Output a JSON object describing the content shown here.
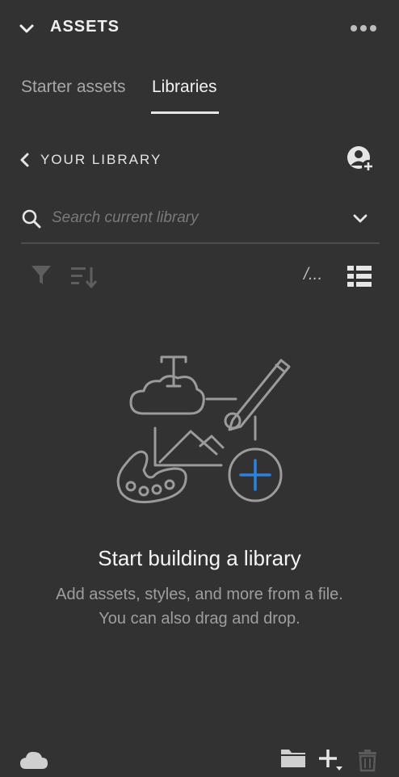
{
  "panel": {
    "title": "ASSETS"
  },
  "tabs": [
    {
      "label": "Starter assets",
      "active": false
    },
    {
      "label": "Libraries",
      "active": true
    }
  ],
  "library": {
    "back_label": "YOUR LIBRARY"
  },
  "search": {
    "placeholder": "Search current library",
    "value": ""
  },
  "toolbar": {
    "view_truncated_label": "/..."
  },
  "empty_state": {
    "title": "Start building a library",
    "description_line1": "Add assets, styles, and more from a file.",
    "description_line2": "You can also drag and drop."
  },
  "icons": {
    "header": [
      "chevron-down-icon",
      "more-options-icon"
    ],
    "library": [
      "chevron-left-icon",
      "add-user-icon"
    ],
    "search": [
      "search-icon",
      "chevron-down-icon"
    ],
    "toolbar": [
      "filter-icon",
      "sort-icon",
      "list-view-icon"
    ],
    "footer": [
      "cloud-icon",
      "folder-icon",
      "add-icon",
      "trash-icon"
    ]
  },
  "colors": {
    "background": "#323232",
    "accent_blue": "#2d7fe0",
    "text_primary": "#f0f0f0",
    "text_secondary": "#9e9e9e",
    "disabled": "#5a5a5a"
  }
}
